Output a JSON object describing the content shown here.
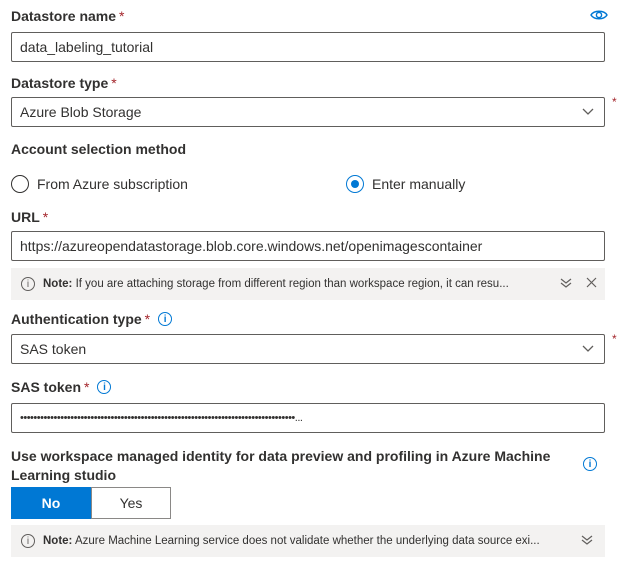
{
  "datastore_name": {
    "label": "Datastore name",
    "required": "*",
    "value": "data_labeling_tutorial",
    "icon": "eye-icon"
  },
  "datastore_type": {
    "label": "Datastore type",
    "required": "*",
    "value": "Azure Blob Storage",
    "outside_required": "*"
  },
  "account_selection": {
    "label": "Account selection method",
    "options": [
      "From Azure subscription",
      "Enter manually"
    ],
    "selected": "Enter manually"
  },
  "url": {
    "label": "URL",
    "required": "*",
    "value": "https://azureopendatastorage.blob.core.windows.net/openimagescontainer"
  },
  "note1": {
    "prefix": "Note:",
    "text": "If you are attaching storage from different region than workspace region, it can resu..."
  },
  "auth_type": {
    "label": "Authentication type",
    "required": "*",
    "value": "SAS token",
    "outside_required": "*"
  },
  "sas_token": {
    "label": "SAS token",
    "required": "*",
    "value": "••••••••••••••••••••••••••••••••••••••••••••••••••••••••••••••••••••••••••••••••••..."
  },
  "managed_identity": {
    "label": "Use workspace managed identity for data preview and profiling in Azure Machine Learning studio",
    "options": [
      "No",
      "Yes"
    ],
    "selected": "No"
  },
  "note2": {
    "prefix": "Note:",
    "text": "Azure Machine Learning service does not validate whether the underlying data source exi..."
  },
  "colors": {
    "accent": "#0078d4",
    "required": "#a4262c",
    "note_bg": "#f3f2f1"
  }
}
